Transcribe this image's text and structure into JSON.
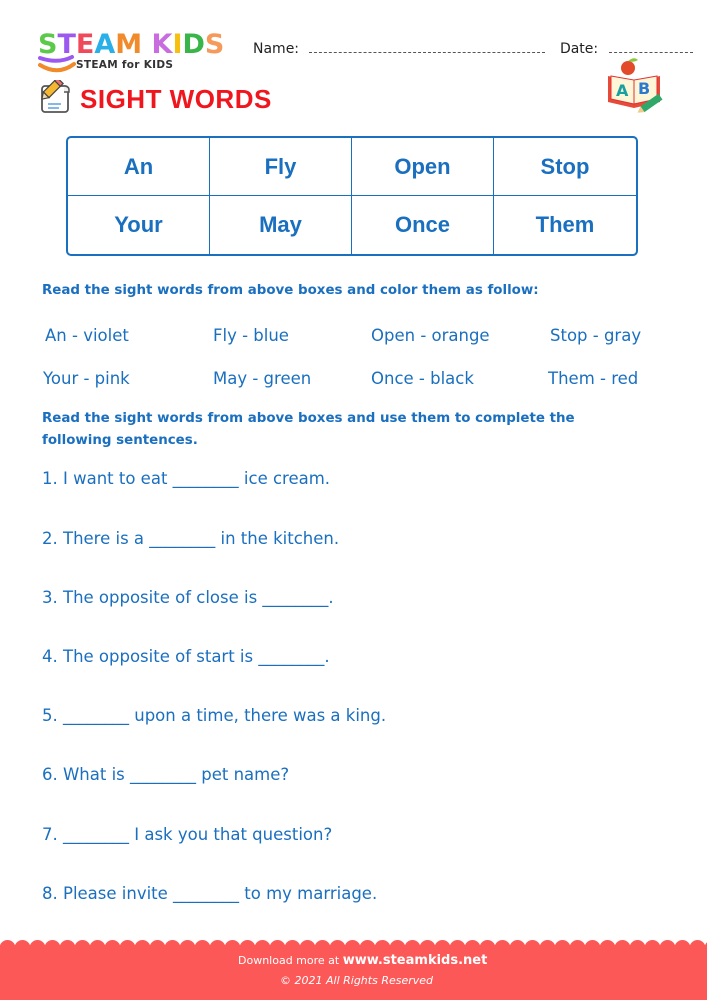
{
  "header": {
    "logo": {
      "letters": [
        {
          "char": "S",
          "color": "#5cc94a"
        },
        {
          "char": "T",
          "color": "#9b59f0"
        },
        {
          "char": "E",
          "color": "#f04a5a"
        },
        {
          "char": "A",
          "color": "#29b0e8"
        },
        {
          "char": "M",
          "color": "#f08a2a"
        },
        {
          "char": " ",
          "color": "#ffffff"
        },
        {
          "char": "K",
          "color": "#c86ce0"
        },
        {
          "char": "I",
          "color": "#f5c010"
        },
        {
          "char": "D",
          "color": "#3ab54a"
        },
        {
          "char": "S",
          "color": "#f59a5a"
        }
      ],
      "tagline": "STEAM for KIDS"
    },
    "name_label": "Name:",
    "date_label": "Date:"
  },
  "title": {
    "text": "SIGHT WORDS",
    "color": "#f0161e",
    "icon": "worksheet-pencil-icon",
    "decor_icon": "abc-book-icon"
  },
  "words_table": {
    "rows": [
      [
        "An",
        "Fly",
        "Open",
        "Stop"
      ],
      [
        "Your",
        "May",
        "Once",
        "Them"
      ]
    ],
    "accent": "#1a6fbf"
  },
  "coloring": {
    "instruction": "Read the sight words from above boxes and color them as follow:",
    "items": [
      [
        "An - violet",
        "Fly - blue",
        "Open - orange",
        "Stop - gray"
      ],
      [
        "Your - pink",
        "May - green",
        "Once - black",
        "Them -  red"
      ]
    ]
  },
  "sentences": {
    "instruction": "Read the sight words from above boxes and use them to complete the following sentences.",
    "items": [
      "1. I want to eat ________ ice cream.",
      "2. There is a ________ in the kitchen.",
      "3. The opposite of close is ________.",
      "4. The opposite of start is ________.",
      "5. ________ upon a time, there was a king.",
      "6. What is ________ pet name?",
      "7. ________ I ask you that question?",
      "8. Please invite ________ to my marriage."
    ]
  },
  "footer": {
    "download_prefix": "Download more at",
    "site": "www.steamkids.net",
    "copyright": "©  2021 All Rights Reserved",
    "color": "#fd5858"
  }
}
